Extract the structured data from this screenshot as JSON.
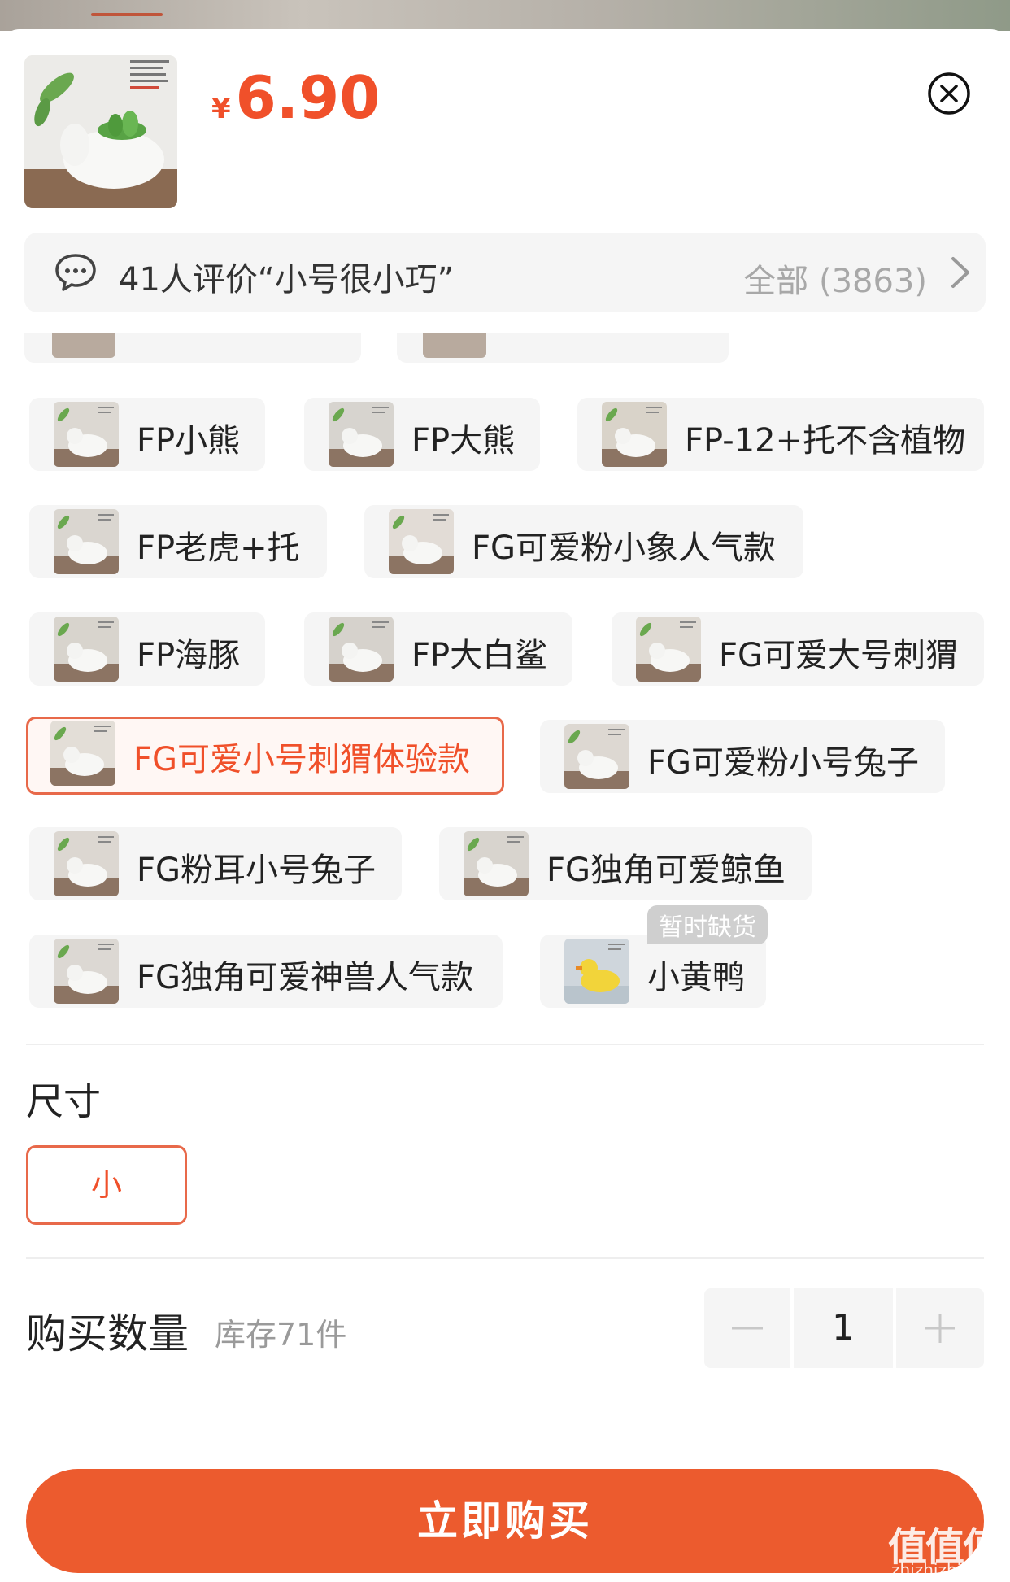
{
  "product": {
    "currency_symbol": "¥",
    "price": "6.90"
  },
  "review": {
    "summary": "41人评价“小号很小巧”",
    "all_label": "全部 (3863)"
  },
  "variants": [
    {
      "label": "FP小熊",
      "selected": false
    },
    {
      "label": "FP大熊",
      "selected": false
    },
    {
      "label": "FP-12+托不含植物",
      "selected": false
    },
    {
      "label": "FP老虎+托",
      "selected": false
    },
    {
      "label": "FG可爱粉小象人气款",
      "selected": false
    },
    {
      "label": "FP海豚",
      "selected": false
    },
    {
      "label": "FP大白鲨",
      "selected": false
    },
    {
      "label": "FG可爱大号刺猬",
      "selected": false
    },
    {
      "label": "FG可爱小号刺猬体验款",
      "selected": true
    },
    {
      "label": "FG可爱粉小号兔子",
      "selected": false
    },
    {
      "label": "FG粉耳小号兔子",
      "selected": false
    },
    {
      "label": "FG独角可爱鲸鱼",
      "selected": false
    },
    {
      "label": "FG独角可爱神兽人气款",
      "selected": false
    },
    {
      "label": "小黄鸭",
      "selected": false,
      "badge": "暂时缺货"
    }
  ],
  "size": {
    "title": "尺寸",
    "options": [
      {
        "label": "小",
        "selected": true
      }
    ]
  },
  "quantity": {
    "label": "购买数量",
    "stock": "库存71件",
    "value": "1"
  },
  "buy_button": "立即购买",
  "watermark": {
    "logo": "值值值",
    "domain": "zhizhizhi.com"
  },
  "colors": {
    "accent": "#f0502a",
    "button": "#ec5b2e",
    "chip_bg": "#f5f5f5"
  }
}
